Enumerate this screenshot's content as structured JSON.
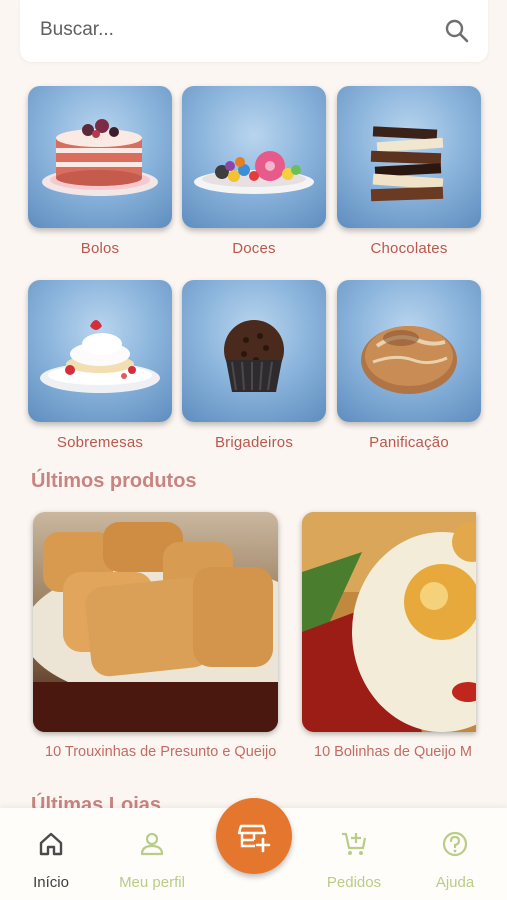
{
  "search": {
    "placeholder": "Buscar..."
  },
  "categories": [
    {
      "label": "Bolos",
      "icon": "cake-icon"
    },
    {
      "label": "Doces",
      "icon": "candy-plate-icon"
    },
    {
      "label": "Chocolates",
      "icon": "chocolate-bars-icon"
    },
    {
      "label": "Sobremesas",
      "icon": "dessert-plate-icon"
    },
    {
      "label": "Brigadeiros",
      "icon": "brigadeiro-icon"
    },
    {
      "label": "Panificação",
      "icon": "bread-icon"
    }
  ],
  "sections": {
    "latest_products": "Últimos produtos",
    "latest_stores": "Últimas Lojas"
  },
  "products": [
    {
      "name": "10 Trouxinhas de Presunto e Queijo"
    },
    {
      "name": "10 Bolinhas de Queijo M"
    }
  ],
  "nav": {
    "home": "Início",
    "profile": "Meu perfil",
    "orders": "Pedidos",
    "help": "Ajuda"
  },
  "colors": {
    "accent": "#e5762e",
    "label": "#b8584f",
    "nav_inactive": "#b9cc88",
    "background": "#fbf6f1"
  }
}
